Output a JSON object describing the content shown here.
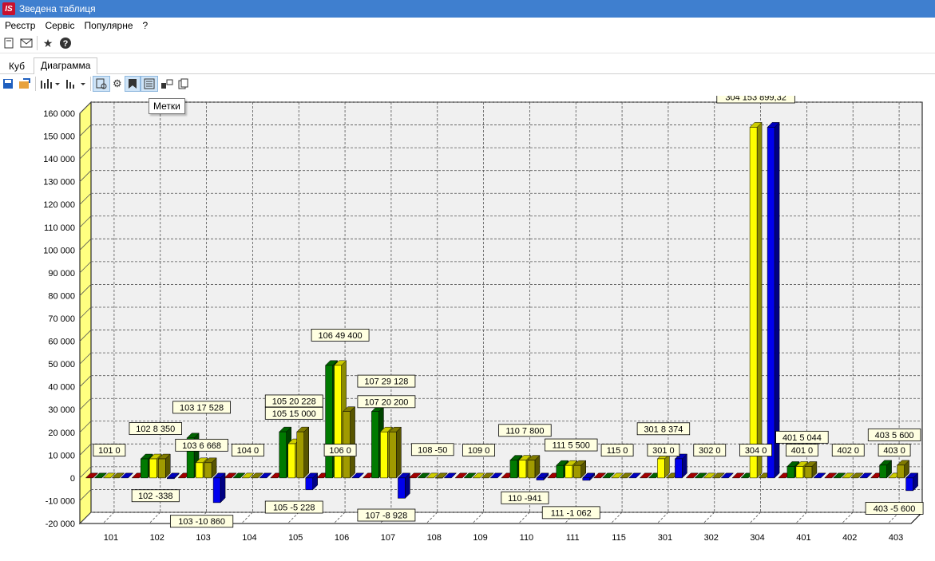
{
  "window": {
    "title": "Зведена таблиця",
    "app_icon_text": "IS"
  },
  "menu": [
    "Реєстр",
    "Сервіс",
    "Популярне",
    "?"
  ],
  "tabs": [
    {
      "label": "Куб",
      "active": false
    },
    {
      "label": "Диаграмма",
      "active": true
    }
  ],
  "tooltip": "Метки",
  "toolbar1_icons": [
    "list-icon",
    "mail-icon",
    "star-icon",
    "help-icon"
  ],
  "toolbar2_icons": [
    "save-icon",
    "export-icon",
    "bar-chart-icon",
    "bar-chart-alt-icon",
    "chart-options-icon",
    "gear-icon",
    "labels-icon",
    "legend-icon",
    "copy-3d-icon",
    "copy-icon"
  ],
  "colors": {
    "red": "#cc0000",
    "green": "#007a00",
    "yellow": "#ffff00",
    "olive": "#a09a00",
    "blue": "#0000ee",
    "label_bg": "#ffffe1",
    "wall": "#ffff80"
  },
  "chart_data": {
    "type": "bar",
    "categories": [
      "101",
      "102",
      "103",
      "104",
      "105",
      "106",
      "107",
      "108",
      "109",
      "110",
      "111",
      "115",
      "301",
      "302",
      "304",
      "401",
      "402",
      "403"
    ],
    "series": [
      {
        "color": "#cc0000",
        "values": [
          0,
          0,
          0,
          0,
          0,
          0,
          0,
          0,
          0,
          0,
          0,
          0,
          0,
          0,
          0,
          0,
          0,
          0
        ]
      },
      {
        "color": "#007a00",
        "values": [
          0,
          8350,
          17528,
          0,
          20228,
          49400,
          29128,
          0,
          0,
          7800,
          5500,
          0,
          0,
          0,
          0,
          5044,
          0,
          5600
        ]
      },
      {
        "color": "#ffff00",
        "values": [
          0,
          8350,
          6668,
          0,
          15000,
          49400,
          20200,
          0,
          0,
          7800,
          5500,
          0,
          8374,
          0,
          153899.32,
          5044,
          0,
          0
        ]
      },
      {
        "color": "#a09a00",
        "values": [
          0,
          8350,
          6668,
          0,
          20228,
          29128,
          20200,
          -50,
          0,
          7800,
          5500,
          0,
          0,
          0,
          0,
          5044,
          0,
          5600
        ]
      },
      {
        "color": "#0000ee",
        "values": [
          0,
          -338,
          -10860,
          0,
          -5228,
          0,
          -8928,
          0,
          0,
          -941,
          -1062,
          0,
          8374,
          0,
          153899.32,
          0,
          0,
          -5600
        ]
      }
    ],
    "ylim": [
      -20000,
      160000
    ],
    "yticks": [
      -20000,
      -10000,
      0,
      10000,
      20000,
      30000,
      40000,
      50000,
      60000,
      70000,
      80000,
      90000,
      100000,
      110000,
      120000,
      130000,
      140000,
      150000,
      160000
    ],
    "ytick_labels": [
      "-20 000",
      "-10 000",
      "0",
      "10 000",
      "20 000",
      "30 000",
      "40 000",
      "50 000",
      "60 000",
      "70 000",
      "80 000",
      "90 000",
      "100 000",
      "110 000",
      "120 000",
      "130 000",
      "140 000",
      "150 000",
      "160 000"
    ],
    "grid": true,
    "data_labels": [
      {
        "text": "101 0",
        "cat": 0,
        "value": 12000
      },
      {
        "text": "102 8 350",
        "cat": 1,
        "value": 21500
      },
      {
        "text": "102 -338",
        "cat": 1,
        "value": -8000
      },
      {
        "text": "103 17 528",
        "cat": 2,
        "value": 30800
      },
      {
        "text": "103 6 668",
        "cat": 2,
        "value": 14200
      },
      {
        "text": "103 -10 860",
        "cat": 2,
        "value": -19200
      },
      {
        "text": "104 0",
        "cat": 3,
        "value": 12000
      },
      {
        "text": "105 20 228",
        "cat": 4,
        "value": 33600
      },
      {
        "text": "105 15 000",
        "cat": 4,
        "value": 28200
      },
      {
        "text": "105 -5 228",
        "cat": 4,
        "value": -13000
      },
      {
        "text": "106 49 400",
        "cat": 5,
        "value": 62500
      },
      {
        "text": "106 0",
        "cat": 5,
        "value": 12000
      },
      {
        "text": "107 29 128",
        "cat": 6,
        "value": 42300
      },
      {
        "text": "107 20 200",
        "cat": 6,
        "value": 33300
      },
      {
        "text": "107 -8 928",
        "cat": 6,
        "value": -16500
      },
      {
        "text": "108 -50",
        "cat": 7,
        "value": 12300
      },
      {
        "text": "109 0",
        "cat": 8,
        "value": 12000
      },
      {
        "text": "110 7 800",
        "cat": 9,
        "value": 20700
      },
      {
        "text": "110 -941",
        "cat": 9,
        "value": -8900
      },
      {
        "text": "111 5 500",
        "cat": 10,
        "value": 14300
      },
      {
        "text": "111 -1 062",
        "cat": 10,
        "value": -15400
      },
      {
        "text": "115 0",
        "cat": 11,
        "value": 12000
      },
      {
        "text": "301 8 374",
        "cat": 12,
        "value": 21400
      },
      {
        "text": "301 0",
        "cat": 12,
        "value": 12000
      },
      {
        "text": "302 0",
        "cat": 13,
        "value": 12000
      },
      {
        "text": "304 153 899,32",
        "cat": 14,
        "value": 167000
      },
      {
        "text": "304 0",
        "cat": 14,
        "value": 12000
      },
      {
        "text": "401 5 044",
        "cat": 15,
        "value": 17700
      },
      {
        "text": "401 0",
        "cat": 15,
        "value": 12000
      },
      {
        "text": "402 0",
        "cat": 16,
        "value": 12000
      },
      {
        "text": "403 5 600",
        "cat": 17,
        "value": 18700
      },
      {
        "text": "403 0",
        "cat": 17,
        "value": 12000
      },
      {
        "text": "403 -5 600",
        "cat": 17,
        "value": -13500
      }
    ]
  }
}
